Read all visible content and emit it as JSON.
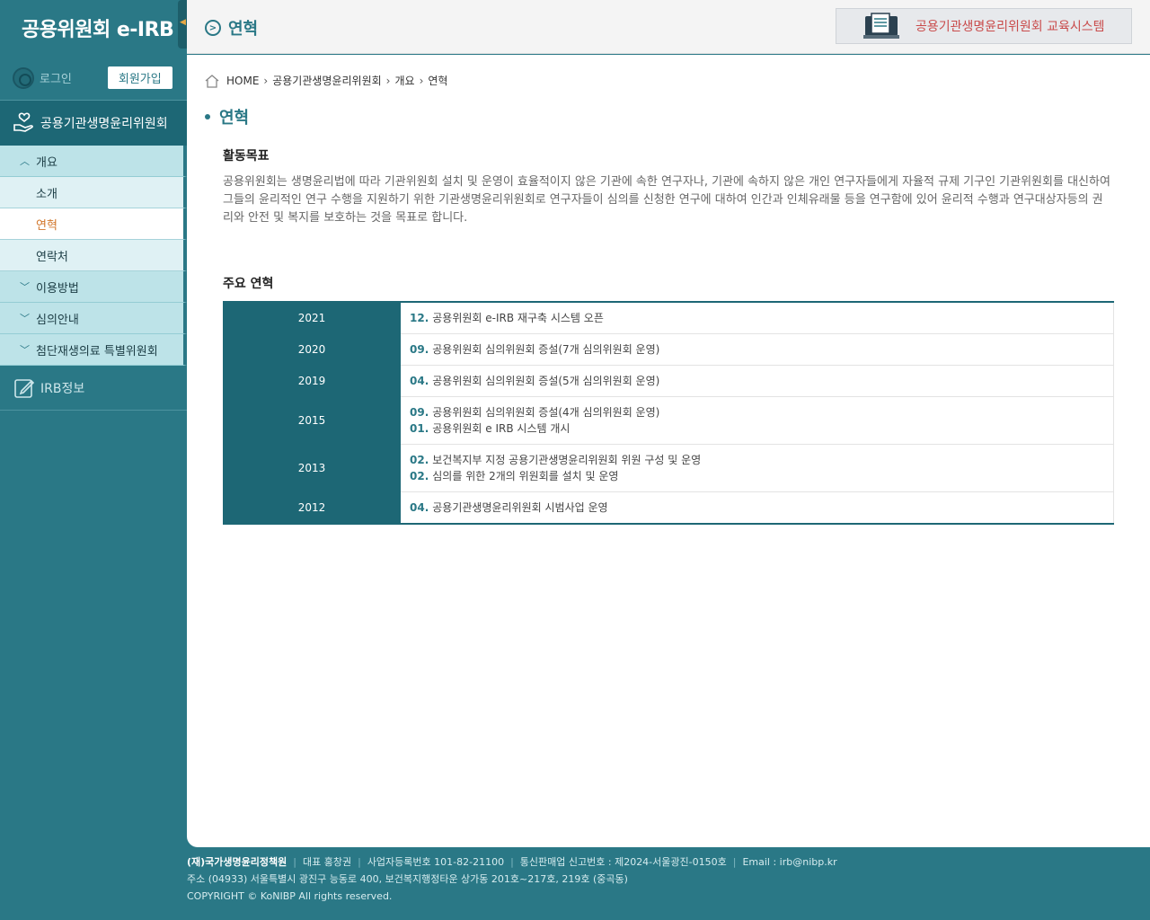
{
  "sidebar": {
    "logo": "공용위원회 e-IRB",
    "login": "로그인",
    "signup": "회원가입",
    "committee": "공용기관생명윤리위원회",
    "groups": {
      "overview": "개요",
      "usage": "이용방법",
      "review": "심의안내",
      "advanced": "첨단재생의료 특별위원회"
    },
    "items": {
      "intro": "소개",
      "history": "연혁",
      "contact": "연락처"
    },
    "irb_info": "IRB정보"
  },
  "header": {
    "title": "연혁",
    "edu_banner": "공용기관생명윤리위원회 교육시스템"
  },
  "breadcrumb": [
    "HOME",
    "공용기관생명윤리위원회",
    "개요",
    "연혁"
  ],
  "page": {
    "title": "연혁",
    "goal_heading": "활동목표",
    "goal_text": "공용위원회는 생명윤리법에 따라 기관위원회 설치 및 운영이 효율적이지 않은 기관에 속한 연구자나, 기관에 속하지 않은 개인 연구자들에게 자율적 규제 기구인 기관위원회를 대신하여 그들의 윤리적인 연구 수행을 지원하기 위한 기관생명윤리위원회로 연구자들이 심의를 신청한 연구에 대하여 인간과 인체유래물 등을 연구함에 있어 윤리적 수행과 연구대상자등의 권리와 안전 및 복지를 보호하는 것을 목표로 합니다.",
    "history_heading": "주요 연혁"
  },
  "history": [
    {
      "year": "2021",
      "events": [
        {
          "month": "12.",
          "text": "공용위원회 e-IRB 재구축 시스템 오픈"
        }
      ]
    },
    {
      "year": "2020",
      "events": [
        {
          "month": "09.",
          "text": "공용위원회 심의위원회 증설(7개 심의위원회 운영)"
        }
      ]
    },
    {
      "year": "2019",
      "events": [
        {
          "month": "04.",
          "text": "공용위원회 심의위원회 증설(5개 심의위원회 운영)"
        }
      ]
    },
    {
      "year": "2015",
      "events": [
        {
          "month": "09.",
          "text": "공용위원회 심의위원회 증설(4개 심의위원회 운영)"
        },
        {
          "month": "01.",
          "text": "공용위원회 e IRB 시스템 개시"
        }
      ]
    },
    {
      "year": "2013",
      "events": [
        {
          "month": "02.",
          "text": "보건복지부 지정 공용기관생명윤리위원회 위원 구성 및 운영"
        },
        {
          "month": "02.",
          "text": "심의를 위한 2개의 위원회를 설치 및 운영"
        }
      ]
    },
    {
      "year": "2012",
      "events": [
        {
          "month": "04.",
          "text": "공용기관생명윤리위원회 시범사업 운영"
        }
      ]
    }
  ],
  "footer": {
    "org": "(재)국가생명윤리정책원",
    "ceo": "대표 홍창권",
    "biz_no": "사업자등록번호 101-82-21100",
    "mail_order": "통신판매업 신고번호 : 제2024-서울광진-0150호",
    "email": "Email : irb@nibp.kr",
    "address": "주소 (04933) 서울특별시 광진구 능동로 400, 보건복지행정타운 상가동 201호~217호, 219호 (중곡동)",
    "copyright": "COPYRIGHT © KoNIBP All rights reserved."
  },
  "colors": {
    "primary": "#2a7886",
    "sidebar_active": "#1d6775",
    "submenu": "#bde3e8",
    "active_item": "#d2762b",
    "edu_text": "#c94b4b"
  }
}
